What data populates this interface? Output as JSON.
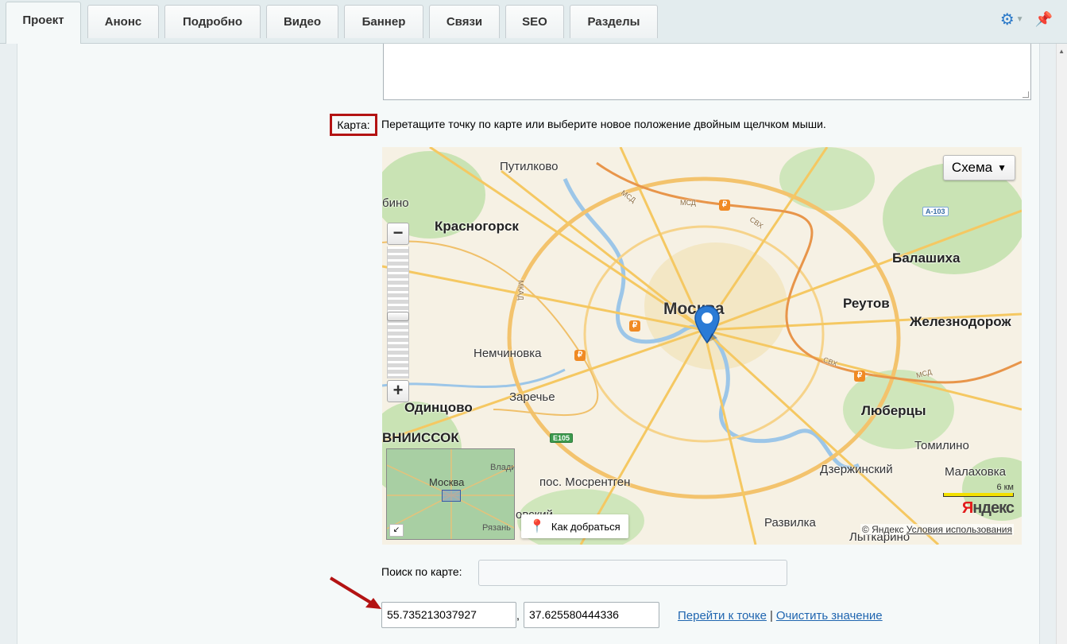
{
  "tabs": [
    "Проект",
    "Анонс",
    "Подробно",
    "Видео",
    "Баннер",
    "Связи",
    "SEO",
    "Разделы"
  ],
  "active_tab": "Проект",
  "toolbar": {
    "settings_icon": "gear-icon",
    "pin_icon": "pin-icon"
  },
  "map_field": {
    "label": "Карта:",
    "hint": "Перетащите точку по карте или выберите новое положение двойным щелчком мыши."
  },
  "map": {
    "scheme_label": "Схема",
    "zoom_out": "−",
    "zoom_in": "+",
    "places": {
      "putilkovo": "Путилково",
      "krasnogorsk": "Красногорск",
      "moskva": "Москва",
      "balashikha": "Балашиха",
      "reutov": "Реутов",
      "zheleznodorozh": "Железнодорож",
      "nemchinovka": "Немчиновка",
      "zarechye": "Заречье",
      "odintsovo": "Одинцово",
      "vniissok": "ВНИИССОК",
      "lyubertsy": "Люберцы",
      "tomilino": "Томилино",
      "dzerzhinsky": "Дзержинский",
      "malakhovka": "Малаховка",
      "mosrentgen": "пос. Мосрентген",
      "razvilka": "Развилка",
      "litkarino": "Лыткарино",
      "bino": "бино",
      "ovsky": "овский"
    },
    "roads": {
      "mkad": "МКАД",
      "msd": "МСД",
      "cvh": "СВХ",
      "a103": "А-103",
      "e105": "E105"
    },
    "minimap": {
      "center": "Москва",
      "top_right": "Влади",
      "bottom_right": "Рязань"
    },
    "route_button": "Как добраться",
    "scale": "6 км",
    "logo_prefix": "Я",
    "logo_rest": "ндекс",
    "copyright": "© Яндекс",
    "terms": "Условия использования"
  },
  "search": {
    "label": "Поиск по карте:",
    "value": ""
  },
  "coordinates": {
    "lat": "55.735213037927",
    "lon": "37.625580444336",
    "separator": ","
  },
  "actions": {
    "goto": "Перейти к точке",
    "separator": "|",
    "clear": "Очистить значение"
  }
}
